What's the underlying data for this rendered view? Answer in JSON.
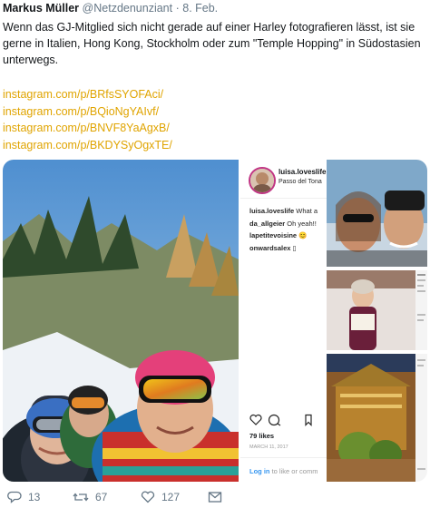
{
  "tweet": {
    "author_name": "Markus Müller",
    "author_handle": "@Netzdenunziant",
    "separator": "·",
    "date": "8. Feb.",
    "text": "Wenn das GJ-Mitglied sich nicht gerade auf einer Harley fotografieren lässt, ist sie gerne in Italien, Hong Kong, Stockholm oder zum \"Temple Hopping\" in Südostasien unterwegs.",
    "links": [
      "instagram.com/p/BRfsSYOFAci/",
      "instagram.com/p/BQioNgYAIvf/",
      "instagram.com/p/BNVF8YaAgxB/",
      "instagram.com/p/BKDYSyOgxTE/"
    ],
    "link_color": "#e0a400"
  },
  "instagram_embed": {
    "username": "luisa.loveslife",
    "location": "Passo del Tona",
    "comments": [
      {
        "user": "luisa.loveslife",
        "text": "What a"
      },
      {
        "user": "da_allgeier",
        "text": "Oh yeah!!"
      },
      {
        "user": "lapetitevoisine",
        "text": "😊"
      },
      {
        "user": "onwardsalex",
        "text": "▯"
      }
    ],
    "likes": "79 likes",
    "post_date": "MARCH 11, 2017",
    "login_link": "Log in",
    "login_text": "to like or comm"
  },
  "actions": {
    "reply_count": "13",
    "retweet_count": "67",
    "like_count": "127"
  },
  "icons": [
    "reply-icon",
    "retweet-icon",
    "like-icon",
    "message-icon"
  ],
  "colors": {
    "text_primary": "#14171a",
    "text_secondary": "#657786",
    "instagram_blue": "#3897f0"
  }
}
